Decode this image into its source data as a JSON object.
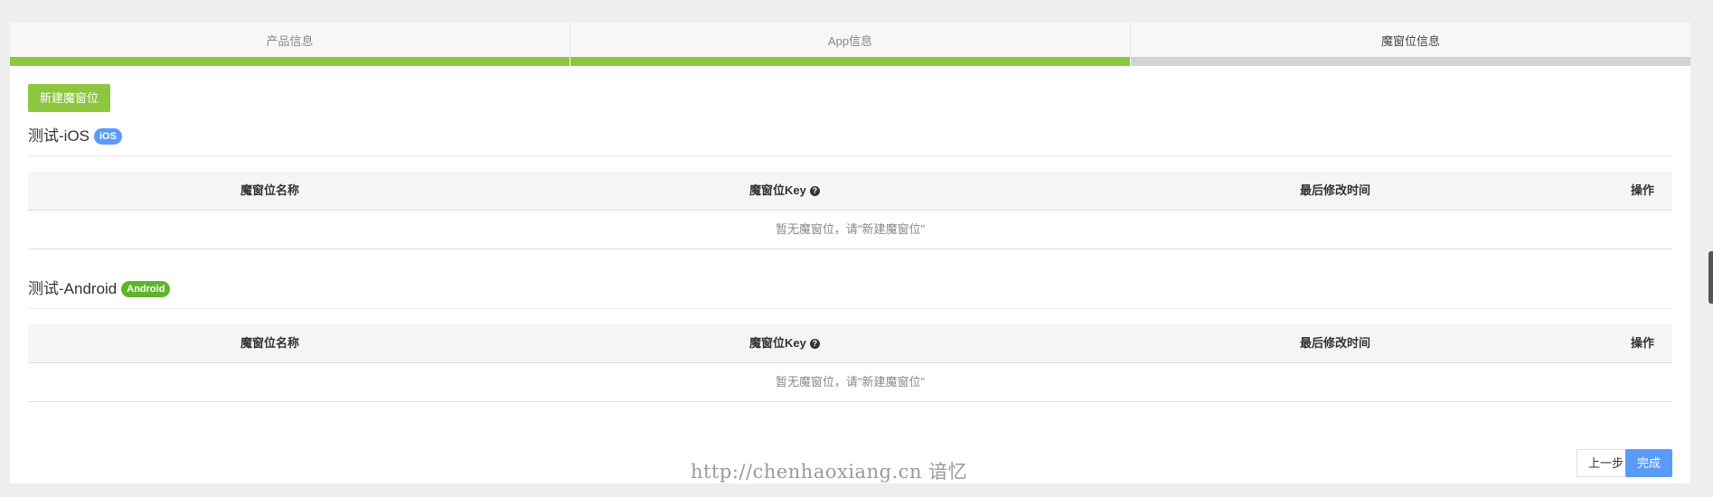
{
  "steps": [
    {
      "label": "产品信息",
      "state": "done"
    },
    {
      "label": "App信息",
      "state": "done"
    },
    {
      "label": "魔窗位信息",
      "state": "current"
    }
  ],
  "colors": {
    "accent_green": "#8dc63f",
    "accent_blue": "#5b9bf8",
    "ios_badge": "#5b9bf8",
    "android_badge": "#5cb52a"
  },
  "new_button_label": "新建魔窗位",
  "sections": [
    {
      "title": "测试-iOS",
      "badge": "iOS",
      "columns": [
        "魔窗位名称",
        "魔窗位Key",
        "最后修改时间",
        "操作"
      ],
      "help_icon": "question-circle-icon",
      "empty_text": "暂无魔窗位，请\"新建魔窗位\""
    },
    {
      "title": "测试-Android",
      "badge": "Android",
      "columns": [
        "魔窗位名称",
        "魔窗位Key",
        "最后修改时间",
        "操作"
      ],
      "help_icon": "question-circle-icon",
      "empty_text": "暂无魔窗位，请\"新建魔窗位\""
    }
  ],
  "footer": {
    "prev_label": "上一步",
    "done_label": "完成"
  },
  "watermark": "http://chenhaoxiang.cn 谙忆"
}
